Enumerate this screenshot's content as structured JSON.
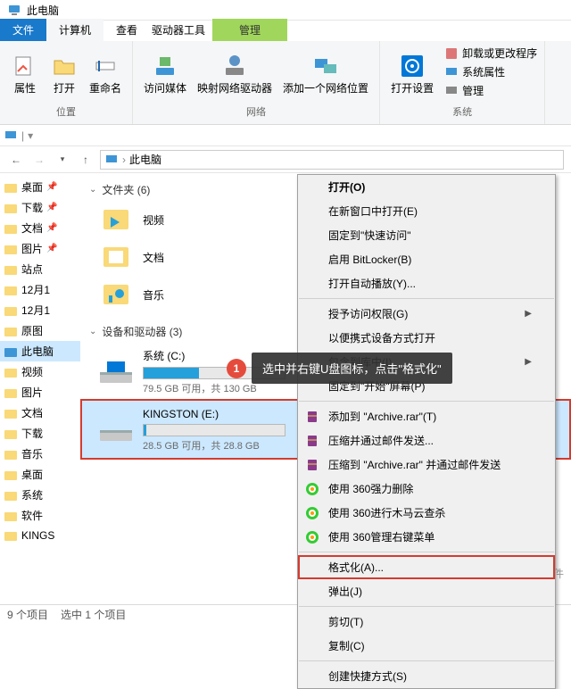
{
  "title": "此电脑",
  "tabs": {
    "file": "文件",
    "computer": "计算机",
    "view": "查看",
    "manage": "管理",
    "driveTools": "驱动器工具"
  },
  "ribbon": {
    "props": "属性",
    "open": "打开",
    "rename": "重命名",
    "media": "访问媒体",
    "mapNet": "映射网络驱动器",
    "addNet": "添加一个网络位置",
    "openSettings": "打开设置",
    "uninstall": "卸载或更改程序",
    "sysProps": "系统属性",
    "mgmt": "管理",
    "groupLoc": "位置",
    "groupNet": "网络",
    "groupSys": "系统"
  },
  "breadcrumb": "此电脑",
  "tree": [
    {
      "l": "桌面",
      "p": true
    },
    {
      "l": "下载",
      "p": true
    },
    {
      "l": "文档",
      "p": true
    },
    {
      "l": "图片",
      "p": true
    },
    {
      "l": "站点",
      "p": false
    },
    {
      "l": "12月1",
      "p": false
    },
    {
      "l": "12月1",
      "p": false
    },
    {
      "l": "原图",
      "p": false
    },
    {
      "l": "此电脑",
      "p": false,
      "sel": true
    },
    {
      "l": "视频",
      "p": false
    },
    {
      "l": "图片",
      "p": false
    },
    {
      "l": "文档",
      "p": false
    },
    {
      "l": "下载",
      "p": false
    },
    {
      "l": "音乐",
      "p": false
    },
    {
      "l": "桌面",
      "p": false
    },
    {
      "l": "系统",
      "p": false
    },
    {
      "l": "软件",
      "p": false
    },
    {
      "l": "KINGS",
      "p": false
    }
  ],
  "sections": {
    "folders": "文件夹 (6)",
    "drives": "设备和驱动器 (3)"
  },
  "folders": [
    {
      "n": "视频"
    },
    {
      "n": "文档"
    },
    {
      "n": "音乐"
    }
  ],
  "drives": [
    {
      "n": "系统 (C:)",
      "info": "79.5 GB 可用，共 130 GB",
      "pct": 39
    },
    {
      "n": "KINGSTON (E:)",
      "info": "28.5 GB 可用，共 28.8 GB",
      "pct": 2,
      "sel": true
    }
  ],
  "status": {
    "items": "9 个项目",
    "sel": "选中 1 个项目"
  },
  "ctx": [
    {
      "t": "打开(O)",
      "b": true
    },
    {
      "t": "在新窗口中打开(E)"
    },
    {
      "t": "固定到\"快速访问\""
    },
    {
      "t": "启用 BitLocker(B)"
    },
    {
      "t": "打开自动播放(Y)..."
    },
    {
      "sep": true
    },
    {
      "t": "授予访问权限(G)",
      "sub": true
    },
    {
      "t": "以便携式设备方式打开"
    },
    {
      "t": "包含到库中(I)",
      "sub": true
    },
    {
      "t": "固定到\"开始\"屏幕(P)"
    },
    {
      "sep": true
    },
    {
      "t": "添加到 \"Archive.rar\"(T)",
      "ic": "rar"
    },
    {
      "t": "压缩并通过邮件发送...",
      "ic": "rar"
    },
    {
      "t": "压缩到 \"Archive.rar\" 并通过邮件发送",
      "ic": "rar"
    },
    {
      "t": "使用 360强力删除",
      "ic": "360"
    },
    {
      "t": "使用 360进行木马云查杀",
      "ic": "360"
    },
    {
      "t": "使用 360管理右键菜单",
      "ic": "360"
    },
    {
      "sep": true
    },
    {
      "t": "格式化(A)...",
      "hl": true
    },
    {
      "t": "弹出(J)"
    },
    {
      "sep": true
    },
    {
      "t": "剪切(T)"
    },
    {
      "t": "复制(C)"
    },
    {
      "sep": true
    },
    {
      "t": "创建快捷方式(S)"
    }
  ],
  "callout": {
    "num": "1",
    "text": "选中并右键U盘图标，点击\"格式化\""
  },
  "watermark": "头杀 @数据蛙软件"
}
